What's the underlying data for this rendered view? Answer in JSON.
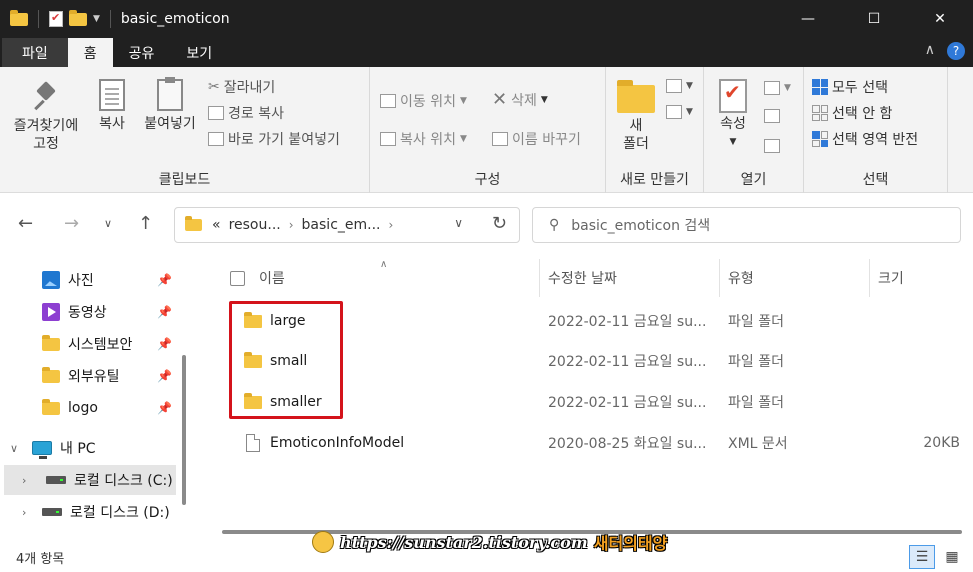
{
  "window": {
    "title": "basic_emoticon"
  },
  "ribbon_tabs": [
    {
      "label": "파일"
    },
    {
      "label": "홈"
    },
    {
      "label": "공유"
    },
    {
      "label": "보기"
    }
  ],
  "ribbon": {
    "clipboard": {
      "pin_label_1": "즐겨찾기에",
      "pin_label_2": "고정",
      "copy": "복사",
      "paste": "붙여넣기",
      "cut": "잘라내기",
      "copy_path": "경로 복사",
      "paste_shortcut": "바로 가기 붙여넣기",
      "group": "클립보드"
    },
    "organize": {
      "move_to": "이동 위치",
      "copy_to": "복사 위치",
      "delete": "삭제",
      "rename": "이름 바꾸기",
      "group": "구성"
    },
    "new": {
      "new_folder_1": "새",
      "new_folder_2": "폴더",
      "group": "새로 만들기"
    },
    "open": {
      "properties": "속성",
      "group": "열기"
    },
    "select": {
      "select_all": "모두 선택",
      "select_none": "선택 안 함",
      "invert": "선택 영역 반전",
      "group": "선택"
    }
  },
  "address": {
    "prefix": "«",
    "crumbs": [
      "resou...",
      "basic_em..."
    ],
    "search_placeholder": "basic_emoticon 검색"
  },
  "nav_pane": [
    {
      "label": "사진",
      "icon": "photo-icon",
      "pinned": true
    },
    {
      "label": "동영상",
      "icon": "video-icon",
      "pinned": true
    },
    {
      "label": "시스템보안",
      "icon": "folder-icon",
      "pinned": true
    },
    {
      "label": "외부유틸",
      "icon": "folder-icon",
      "pinned": true
    },
    {
      "label": "logo",
      "icon": "folder-icon",
      "pinned": true
    },
    {
      "label": "내 PC",
      "icon": "pc-icon"
    },
    {
      "label": "로컬 디스크 (C:)",
      "icon": "drive-icon"
    },
    {
      "label": "로컬 디스크 (D:)",
      "icon": "drive-icon"
    }
  ],
  "columns": {
    "name": "이름",
    "date": "수정한 날짜",
    "type": "유형",
    "size": "크기"
  },
  "files": [
    {
      "name": "large",
      "date": "2022-02-11 금요일 su...",
      "type": "파일 폴더",
      "size": "",
      "kind": "folder"
    },
    {
      "name": "small",
      "date": "2022-02-11 금요일 su...",
      "type": "파일 폴더",
      "size": "",
      "kind": "folder"
    },
    {
      "name": "smaller",
      "date": "2022-02-11 금요일 su...",
      "type": "파일 폴더",
      "size": "",
      "kind": "folder"
    },
    {
      "name": "EmoticonInfoModel",
      "date": "2020-08-25 화요일 su...",
      "type": "XML 문서",
      "size": "20KB",
      "kind": "file"
    }
  ],
  "status": {
    "count": "4개 항목"
  },
  "watermark": {
    "url": "https://sunstar2.tistory.com",
    "name": "새터의태양"
  },
  "colors": {
    "highlight": "#d4131b",
    "folder": "#f4c542",
    "accent": "#2f79d8"
  }
}
